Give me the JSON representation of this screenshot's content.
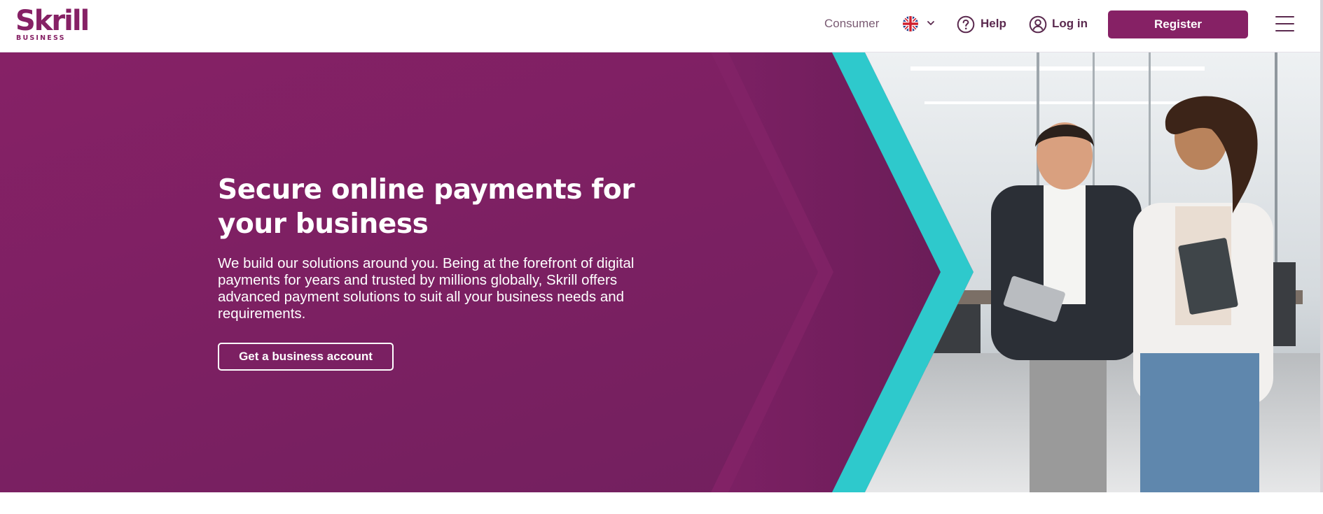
{
  "header": {
    "logo": {
      "wordmark": "Skrill",
      "sub": "BUSINESS"
    },
    "nav": {
      "consumer": "Consumer",
      "language_icon": "uk-flag-icon",
      "help": "Help",
      "login": "Log in"
    },
    "register_label": "Register",
    "menu_icon": "hamburger-icon"
  },
  "hero": {
    "title": "Secure online payments for your business",
    "text": "We build our solutions around you. Being at the forefront of digital payments for years and trusted by millions globally, Skrill offers advanced payment solutions to suit all your business needs and requirements.",
    "cta_label": "Get a business account"
  },
  "colors": {
    "brand_purple": "#862165",
    "hero_bg": "#7a2163",
    "accent_teal": "#2ec9cc",
    "nav_text": "#5b2a4f"
  }
}
